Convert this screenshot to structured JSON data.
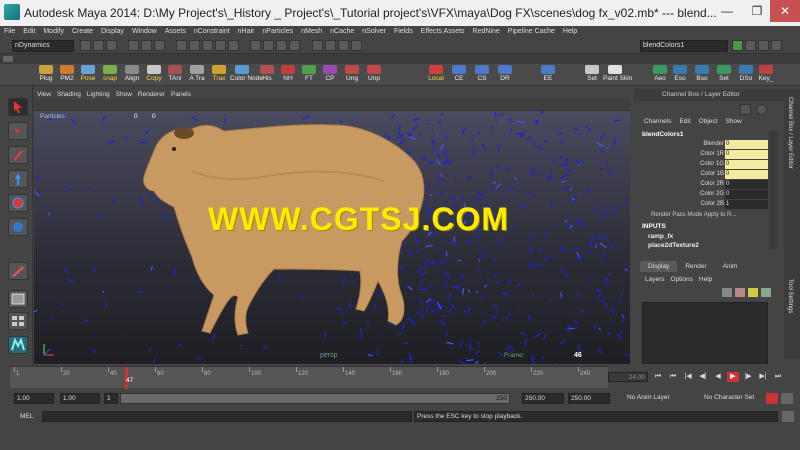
{
  "window": {
    "title": "Autodesk Maya 2014: D:\\My Project's\\_History _ Project's\\_Tutorial project's\\VFX\\maya\\Dog FX\\scenes\\dog fx_v02.mb*   ---   blend...",
    "controls": [
      "—",
      "❐",
      "✕"
    ]
  },
  "menubar": [
    "File",
    "Edit",
    "Modify",
    "Create",
    "Display",
    "Window",
    "Assets",
    "nConstraint",
    "nHair",
    "nParticles",
    "nMesh",
    "nCache",
    "nSolver",
    "Fields",
    "Effects Assets",
    "RedNine",
    "Pipeline Cache",
    "Help"
  ],
  "status_line": {
    "menu_set": "nDynamics",
    "input_field": "blendColors1"
  },
  "shelf": {
    "items": [
      {
        "label": "Plug",
        "color": "#c9a23a",
        "yellow": false
      },
      {
        "label": "PM2",
        "color": "#d07a2a",
        "yellow": false
      },
      {
        "label": "Pose",
        "color": "#6aa3d8",
        "yellow": true
      },
      {
        "label": "snap",
        "color": "#7ab04a",
        "yellow": true
      },
      {
        "label": "Align",
        "color": "#8a8a8a",
        "yellow": false
      },
      {
        "label": "Copy",
        "color": "#c8c8c8",
        "yellow": true
      },
      {
        "label": "TAni",
        "color": "#a85050",
        "yellow": false
      },
      {
        "label": "A Tra",
        "color": "#a0a0a0",
        "yellow": false
      },
      {
        "label": "Trax",
        "color": "#d0a030",
        "yellow": true
      },
      {
        "label": "Color Node",
        "color": "#5a9ad0",
        "yellow": false
      },
      {
        "label": "His",
        "color": "#b05050",
        "yellow": false
      },
      {
        "label": "NH",
        "color": "#c04040",
        "yellow": false
      },
      {
        "label": "FT",
        "color": "#50a050",
        "yellow": false
      },
      {
        "label": "CP",
        "color": "#9a4ab0",
        "yellow": false
      },
      {
        "label": "Ung",
        "color": "#c04848",
        "yellow": false
      },
      {
        "label": "Unp",
        "color": "#c04848",
        "yellow": false
      },
      {
        "label": "Local",
        "color": "#d04040",
        "yellow": true
      },
      {
        "label": "CE",
        "color": "#4a7ac8",
        "yellow": false
      },
      {
        "label": "CS",
        "color": "#4a7ac8",
        "yellow": false
      },
      {
        "label": "DR",
        "color": "#4a7ac8",
        "yellow": false
      },
      {
        "label": "EE",
        "color": "#4a7ac8",
        "yellow": false
      },
      {
        "label": "Set",
        "color": "#c8c8c8",
        "yellow": false
      },
      {
        "label": "Paint Skin",
        "color": "#e0e0e0",
        "yellow": false
      },
      {
        "label": "Aeo",
        "color": "#3a9a5a",
        "yellow": false
      },
      {
        "label": "Eso",
        "color": "#3a7ab0",
        "yellow": false
      },
      {
        "label": "Bso",
        "color": "#3a7ab0",
        "yellow": false
      },
      {
        "label": "Set",
        "color": "#3a9a5a",
        "yellow": false
      },
      {
        "label": "DSo",
        "color": "#3a7ab0",
        "yellow": false
      },
      {
        "label": "Key_",
        "color": "#c04040",
        "yellow": false
      }
    ]
  },
  "viewport": {
    "menu": [
      "View",
      "Shading",
      "Lighting",
      "Show",
      "Renderer",
      "Panels"
    ],
    "hud_particles": "Particles:",
    "hud_val1": "0",
    "hud_val2": "0",
    "camera_label": "persp",
    "frame_label": "Frame:",
    "frame_value": "46",
    "watermark": "WWW.CGTSJ.COM"
  },
  "channel_box": {
    "header": "Channel Box / Layer Editor",
    "menu": [
      "Channels",
      "Edit",
      "Object",
      "Show"
    ],
    "node": "blendColors1",
    "attrs": [
      {
        "name": "Blender",
        "value": "0",
        "highlight": true
      },
      {
        "name": "Color 1R",
        "value": "0",
        "highlight": true
      },
      {
        "name": "Color 1G",
        "value": "0",
        "highlight": true
      },
      {
        "name": "Color 1B",
        "value": "0",
        "highlight": true
      },
      {
        "name": "Color 2R",
        "value": "0",
        "highlight": false
      },
      {
        "name": "Color 2G",
        "value": "0",
        "highlight": false
      },
      {
        "name": "Color 2B",
        "value": "1",
        "highlight": false
      }
    ],
    "render_pass_mode": "Render Pass Mode  Apply to R...",
    "inputs_header": "INPUTS",
    "inputs": [
      "ramp_fx",
      "place2dTexture2"
    ]
  },
  "layer_editor": {
    "tabs": [
      "Display",
      "Render",
      "Anim"
    ],
    "active_tab": "Display",
    "menu": [
      "Layers",
      "Options",
      "Help"
    ]
  },
  "side_tabs": [
    "Channel Box / Layer Editor",
    "Tool Settings"
  ],
  "time_slider": {
    "ticks": [
      "1",
      "20",
      "40",
      "60",
      "80",
      "100",
      "120",
      "140",
      "160",
      "180",
      "200",
      "220",
      "240"
    ],
    "current_frame": "47",
    "current_frame_field": "24.00"
  },
  "playback": [
    "⏮",
    "⏮",
    "|◀",
    "◀|",
    "◀",
    "▶",
    "|▶",
    "▶|",
    "⏭"
  ],
  "range_slider": {
    "start": "1.00",
    "anim_start": "1.00",
    "range_field": "1",
    "range_end": "250",
    "anim_end": "250.00",
    "end": "250.00",
    "anim_layer": "No Anim Layer",
    "character_set": "No Character Set"
  },
  "command_line": {
    "label": "MEL",
    "feedback": "Press the ESC key to stop playback."
  }
}
